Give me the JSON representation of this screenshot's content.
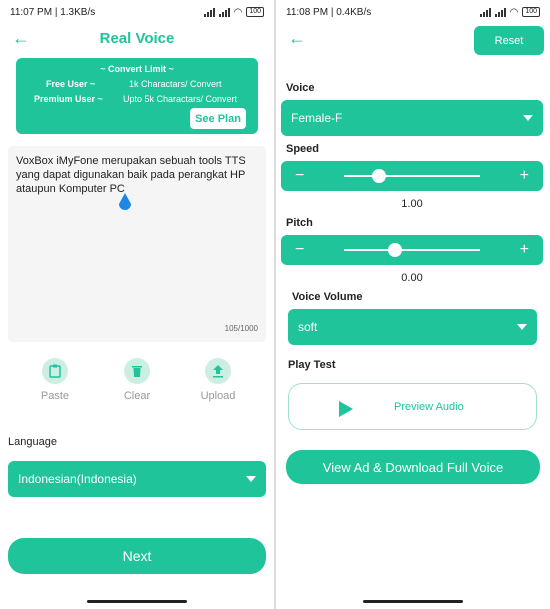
{
  "left": {
    "status": {
      "time": "11:07 PM",
      "net": "1.3KB/s",
      "battery": "100"
    },
    "title": "Real Voice",
    "limit": {
      "heading": "~ Convert Limit ~",
      "free_label": "Free User ~",
      "free_value": "1k Charactars/ Convert",
      "premium_label": "Premium User ~",
      "premium_value": "Upto 5k Charactars/ Convert",
      "see_plan": "See Plan"
    },
    "text": "VoxBox iMyFone merupakan sebuah tools TTS yang dapat digunakan baik pada perangkat HP ataupun Komputer PC",
    "counter": "105/1000",
    "tools": {
      "paste": "Paste",
      "clear": "Clear",
      "upload": "Upload"
    },
    "language_label": "Language",
    "language_value": "Indonesian(Indonesia)",
    "next": "Next"
  },
  "right": {
    "status": {
      "time": "11:08 PM",
      "net": "0.4KB/s",
      "battery": "100"
    },
    "reset": "Reset",
    "voice_label": "Voice",
    "voice_value": "Female-F",
    "speed_label": "Speed",
    "speed_value": "1.00",
    "pitch_label": "Pitch",
    "pitch_value": "0.00",
    "volume_label": "Voice Volume",
    "volume_value": "soft",
    "play_test_label": "Play Test",
    "preview": "Preview Audio",
    "download": "View Ad & Download Full Voice",
    "minus": "−",
    "plus": "+"
  },
  "colors": {
    "accent": "#1fc49b"
  },
  "icons": [
    "back-arrow-icon",
    "clipboard-icon",
    "trash-icon",
    "upload-icon",
    "play-icon",
    "caret-down-icon"
  ]
}
